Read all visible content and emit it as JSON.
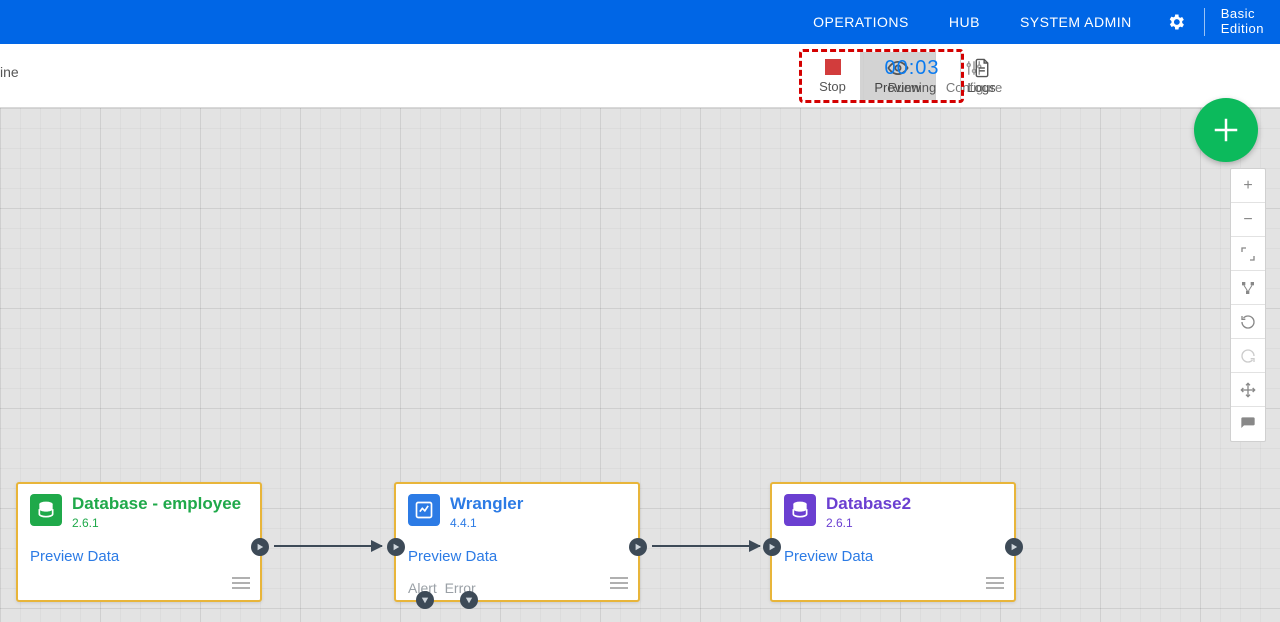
{
  "topnav": {
    "operations": "OPERATIONS",
    "hub": "HUB",
    "system_admin": "SYSTEM ADMIN",
    "edition_line1": "Basic",
    "edition_line2": "Edition"
  },
  "subbar": {
    "left_text": "ine",
    "preview": "Preview",
    "configure": "Configure",
    "stop": "Stop",
    "time": "00:03",
    "running": "Running",
    "logs": "Logs"
  },
  "side_tools": {
    "zoom_in": "+",
    "zoom_out": "−"
  },
  "nodes": {
    "n1": {
      "title": "Database - employee",
      "version": "2.6.1",
      "preview": "Preview Data"
    },
    "n2": {
      "title": "Wrangler",
      "version": "4.4.1",
      "preview": "Preview Data",
      "alert": "Alert",
      "error": "Error"
    },
    "n3": {
      "title": "Database2",
      "version": "2.6.1",
      "preview": "Preview Data"
    }
  }
}
